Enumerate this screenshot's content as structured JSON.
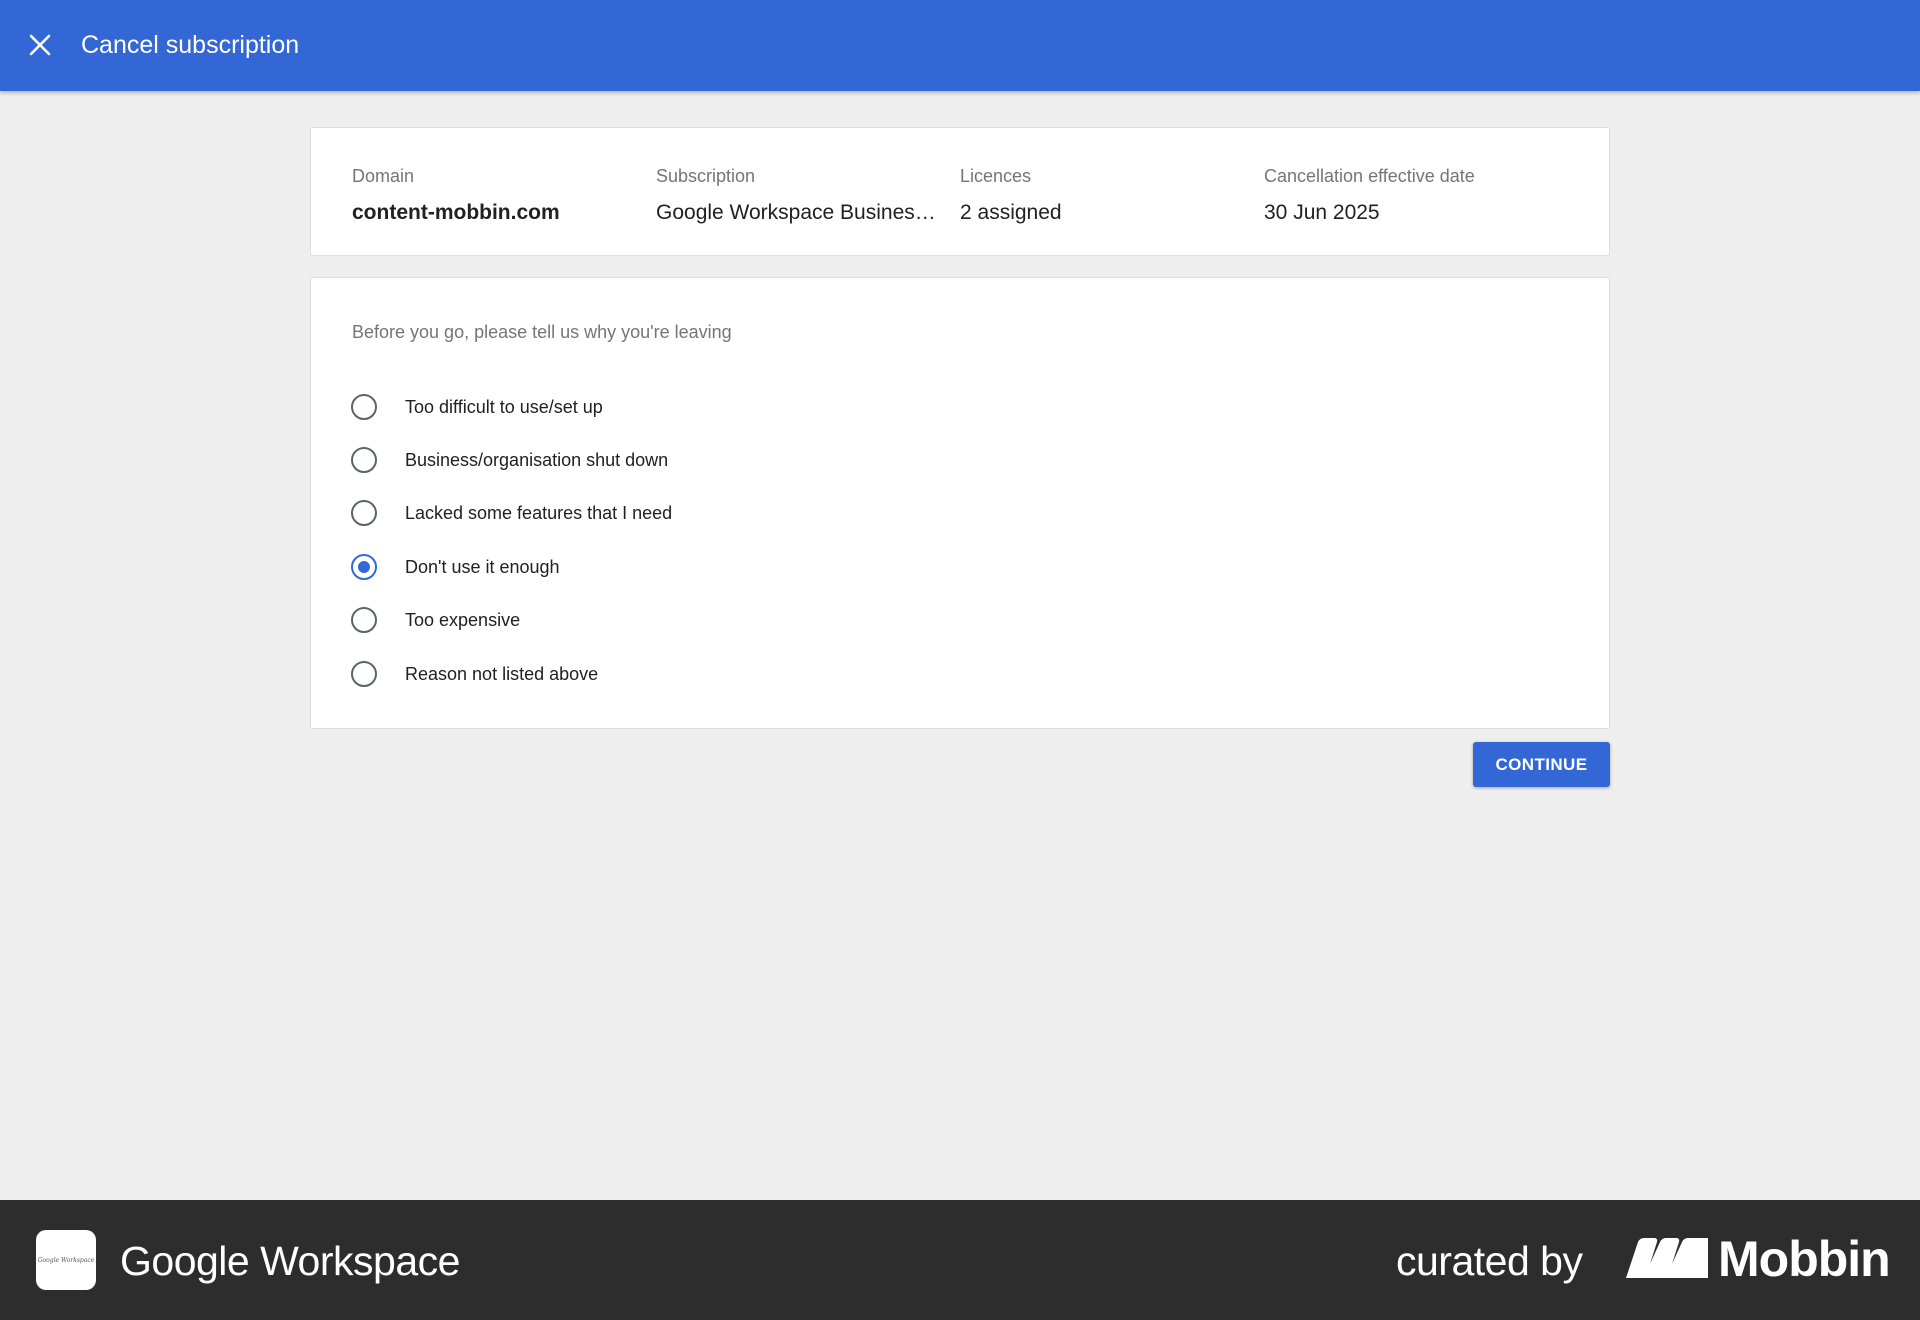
{
  "header": {
    "title": "Cancel subscription",
    "close_icon": "close-icon"
  },
  "summary": {
    "domain": {
      "label": "Domain",
      "value": "content-mobbin.com"
    },
    "subscription": {
      "label": "Subscription",
      "value": "Google Workspace Business S..."
    },
    "licences": {
      "label": "Licences",
      "value": "2 assigned"
    },
    "cancellation_date": {
      "label": "Cancellation effective date",
      "value": "30 Jun 2025"
    }
  },
  "reasons": {
    "prompt": "Before you go, please tell us why you're leaving",
    "selected_index": 3,
    "options": [
      {
        "label": "Too difficult to use/set up",
        "selected": false
      },
      {
        "label": "Business/organisation shut down",
        "selected": false
      },
      {
        "label": "Lacked some features that I need",
        "selected": false
      },
      {
        "label": "Don't use it enough",
        "selected": true
      },
      {
        "label": "Too expensive",
        "selected": false
      },
      {
        "label": "Reason not listed above",
        "selected": false
      }
    ]
  },
  "actions": {
    "continue_label": "CONTINUE"
  },
  "footer": {
    "app_icon_text": "Google Workspace",
    "app_name": "Google Workspace",
    "curated_label": "curated by",
    "brand": "Mobbin"
  },
  "colors": {
    "primary": "#3367d6",
    "background": "#eeeeee",
    "footer": "#2d2d2d"
  }
}
